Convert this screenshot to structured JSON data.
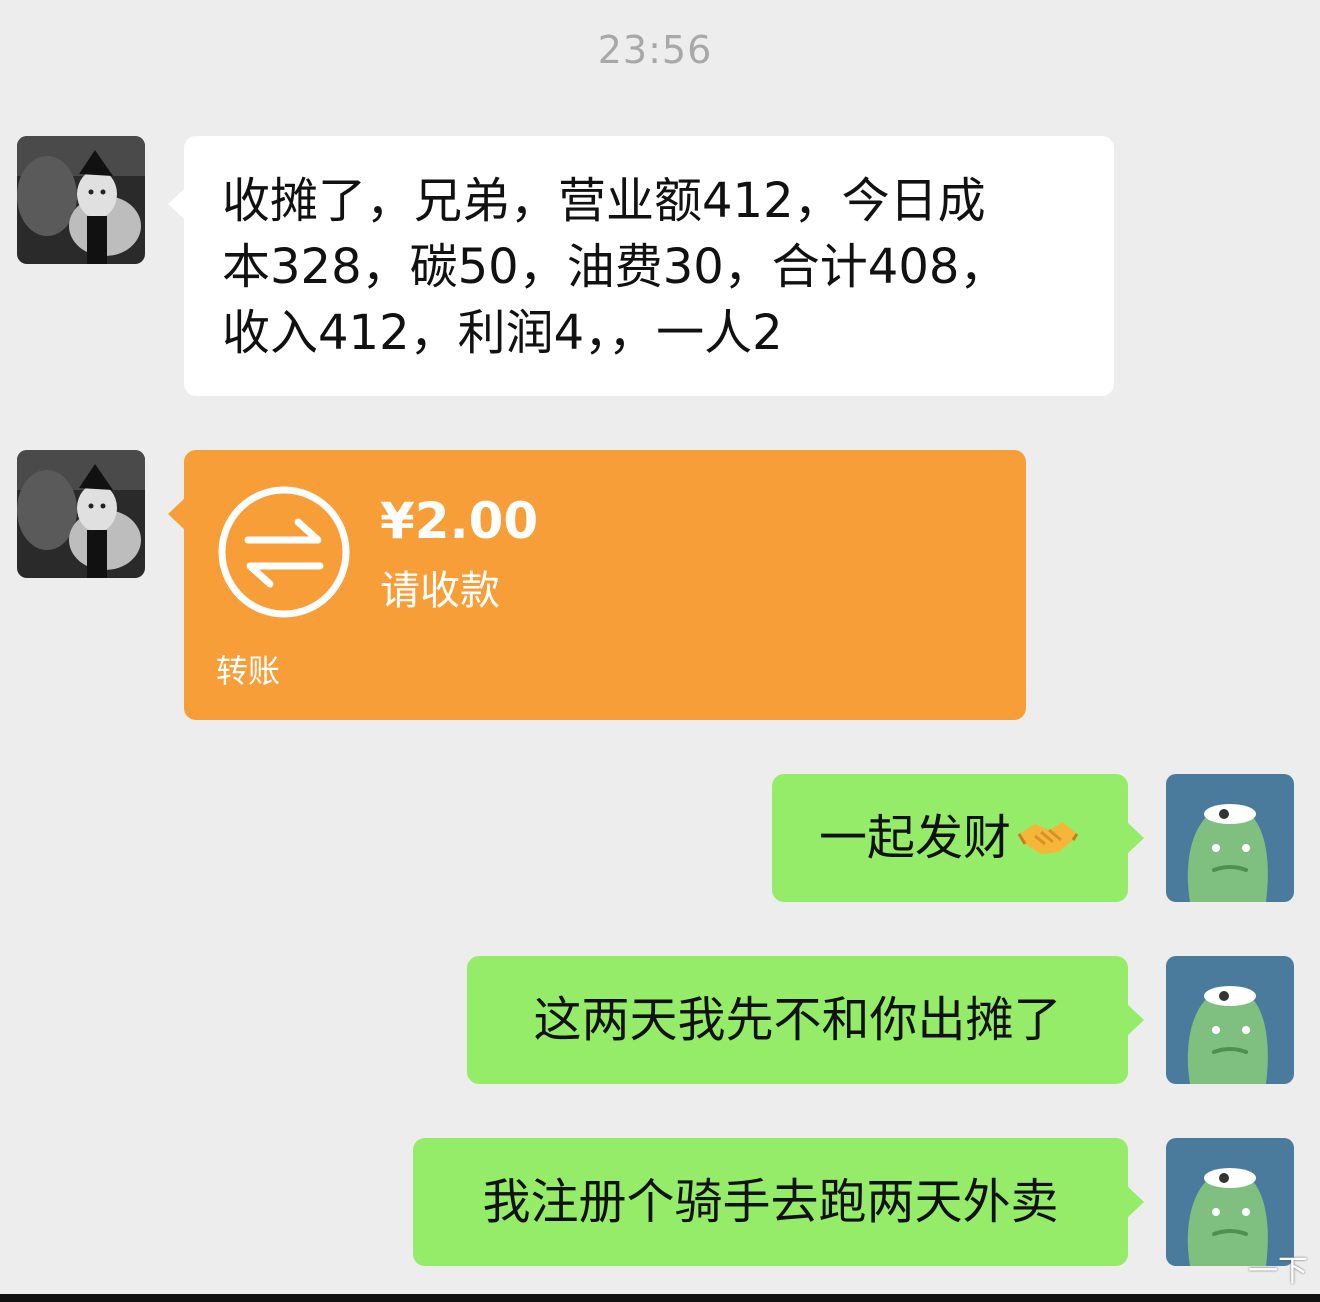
{
  "chat": {
    "timestamp": "23:56",
    "messages": [
      {
        "side": "left",
        "type": "text",
        "lines": [
          "收摊了，兄弟，营业额412，今日成",
          "本328，碳50，油费30，合计408，",
          "收入412，利润4，，一人2"
        ]
      },
      {
        "side": "left",
        "type": "transfer",
        "amount": "¥2.00",
        "status": "请收款",
        "label": "转账"
      },
      {
        "side": "right",
        "type": "text",
        "text": "一起发财",
        "emoji": "handshake-emoji"
      },
      {
        "side": "right",
        "type": "text",
        "text": "这两天我先不和你出摊了"
      },
      {
        "side": "right",
        "type": "text",
        "text": "我注册个骑手去跑两天外卖"
      }
    ]
  },
  "avatars": {
    "friend": "friend-avatar-photo",
    "me": "me-avatar-green-cartoon"
  },
  "watermark": {
    "text": "一下"
  },
  "colors": {
    "background": "#ededed",
    "incoming_bubble": "#ffffff",
    "outgoing_bubble": "#95ec69",
    "transfer_bubble": "#f79e39",
    "timestamp": "#a8a8a8",
    "me_avatar_bg": "#4a7b9d",
    "me_avatar_figure": "#7fbf7f"
  }
}
